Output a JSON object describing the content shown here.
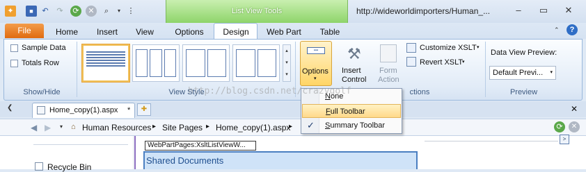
{
  "window": {
    "url": "http://wideworldimporters/Human_...",
    "context_group": "List View Tools"
  },
  "tabs": [
    {
      "label": "File"
    },
    {
      "label": "Home"
    },
    {
      "label": "Insert"
    },
    {
      "label": "View"
    },
    {
      "label": "Options"
    },
    {
      "label": "Design"
    },
    {
      "label": "Web Part"
    },
    {
      "label": "Table"
    }
  ],
  "ribbon": {
    "show_hide": {
      "label": "Show/Hide",
      "sample_data": "Sample Data",
      "totals_row": "Totals Row"
    },
    "view_style": {
      "label": "View Style"
    },
    "options": {
      "label": "Options"
    },
    "insert_control": {
      "line1": "Insert",
      "line2": "Control"
    },
    "form_action": {
      "line1": "Form",
      "line2": "Action"
    },
    "actions_label": "ctions",
    "customize_xslt": "Customize XSLT",
    "revert_xslt": "Revert XSLT",
    "preview": {
      "title": "Data View Preview:",
      "value": "Default Previ...",
      "label": "Preview"
    }
  },
  "menu": {
    "items": [
      {
        "label": "None",
        "underline": "N",
        "rest": "one"
      },
      {
        "label": "Full Toolbar",
        "underline": "F",
        "rest": "ull Toolbar"
      },
      {
        "label": "Summary Toolbar",
        "underline": "S",
        "rest": "ummary Toolbar"
      }
    ]
  },
  "doc": {
    "tab_label": "Home_copy(1).aspx",
    "tab_modified": "*",
    "breadcrumb": [
      "Human Resources",
      "Site Pages",
      "Home_copy(1).aspx"
    ],
    "recycle_bin": "Recycle Bin",
    "webpart_label": "WebPartPages:XsltListViewW...",
    "shared_documents": "Shared Documents"
  },
  "watermark": "http://blog.csdn.net/crazygolf",
  "colors": {
    "file_tab": "#e06b10",
    "context_green": "#8ed46a",
    "selection": "#ffd567"
  }
}
